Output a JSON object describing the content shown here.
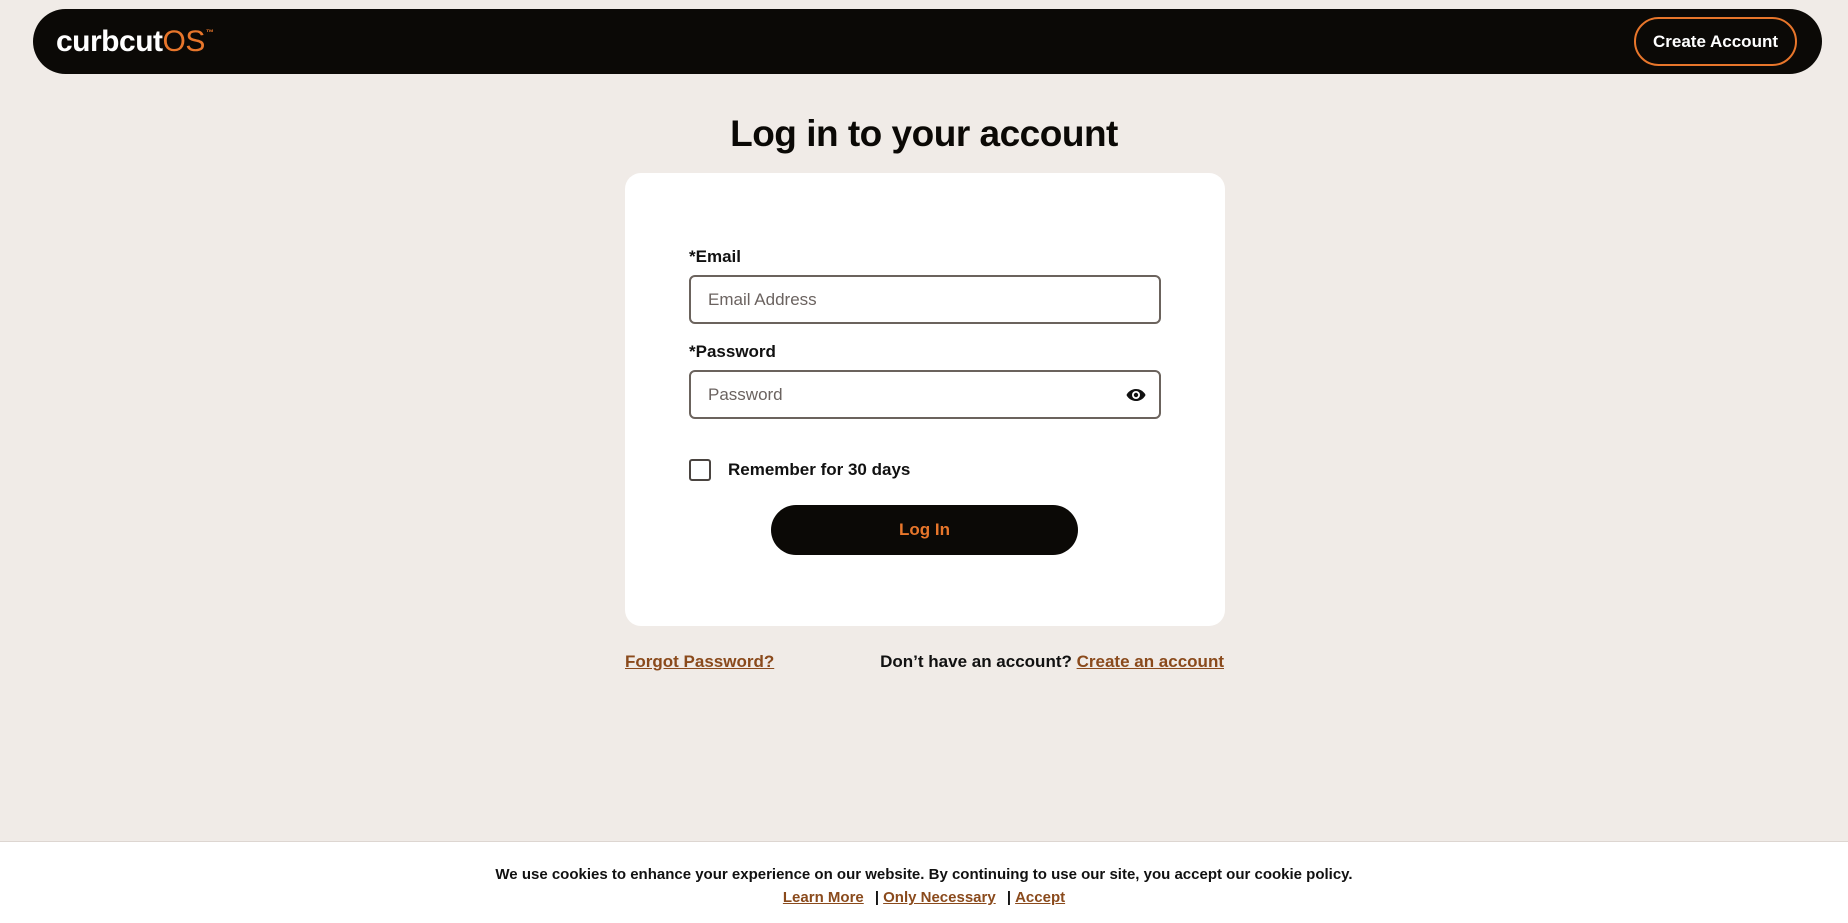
{
  "header": {
    "logo_primary": "curbcut",
    "logo_secondary": "OS",
    "logo_tm": "™",
    "create_account_label": "Create Account"
  },
  "page": {
    "title": "Log in to your account"
  },
  "form": {
    "email_label": "*Email",
    "email_placeholder": "Email Address",
    "email_value": "",
    "password_label": "*Password",
    "password_placeholder": "Password",
    "password_value": "",
    "remember_label": "Remember for 30 days",
    "remember_checked": false,
    "login_label": "Log In"
  },
  "footer_links": {
    "forgot_password": "Forgot Password?",
    "no_account_text": "Don’t have an account?",
    "create_link": "Create an account"
  },
  "cookie_banner": {
    "message": "We use cookies to enhance your experience on our website. By continuing to use our site, you accept our cookie policy.",
    "learn_more": "Learn More",
    "only_necessary": "Only Necessary",
    "accept": "Accept",
    "separator": "|"
  },
  "colors": {
    "accent": "#e8762b",
    "dark": "#0b0906",
    "background": "#f0ebe7",
    "link": "#8a4a1c"
  },
  "icons": {
    "password_toggle": "eye-icon"
  }
}
